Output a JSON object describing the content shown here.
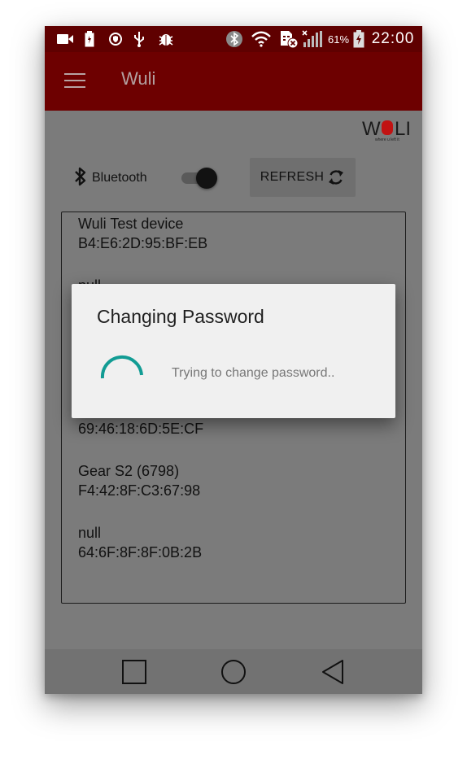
{
  "statusbar": {
    "left_icons": [
      "video-camera-icon",
      "battery-saver-icon",
      "shield-icon",
      "usb-icon",
      "bug-icon"
    ],
    "right_icons": [
      "bluetooth-icon",
      "wifi-icon",
      "sim-error-icon",
      "signal-icon",
      "battery-icon"
    ],
    "battery_percent": "61%",
    "time": "22:00"
  },
  "appbar": {
    "title": "Wuli",
    "menu_icon": "hamburger-menu-icon",
    "background": "#6d0000"
  },
  "logo": {
    "text": "WULI",
    "tagline": "where u left it"
  },
  "controls": {
    "bluetooth_label": "Bluetooth",
    "bluetooth_on": true,
    "refresh_label": "REFRESH"
  },
  "devices": [
    {
      "name": "Wuli Test device",
      "address": "B4:E6:2D:95:BF:EB"
    },
    {
      "name": "null",
      "address": ""
    },
    {
      "name": "",
      "address": "69:46:18:6D:5E:CF"
    },
    {
      "name": "Gear S2 (6798)",
      "address": "F4:42:8F:C3:67:98"
    },
    {
      "name": "null",
      "address": "64:6F:8F:8F:0B:2B"
    }
  ],
  "dialog": {
    "title": "Changing Password",
    "message": "Trying to change password..",
    "spinner_color": "#129c94"
  },
  "navbar": {
    "buttons": [
      "recents-square-icon",
      "home-circle-icon",
      "back-triangle-icon"
    ]
  }
}
